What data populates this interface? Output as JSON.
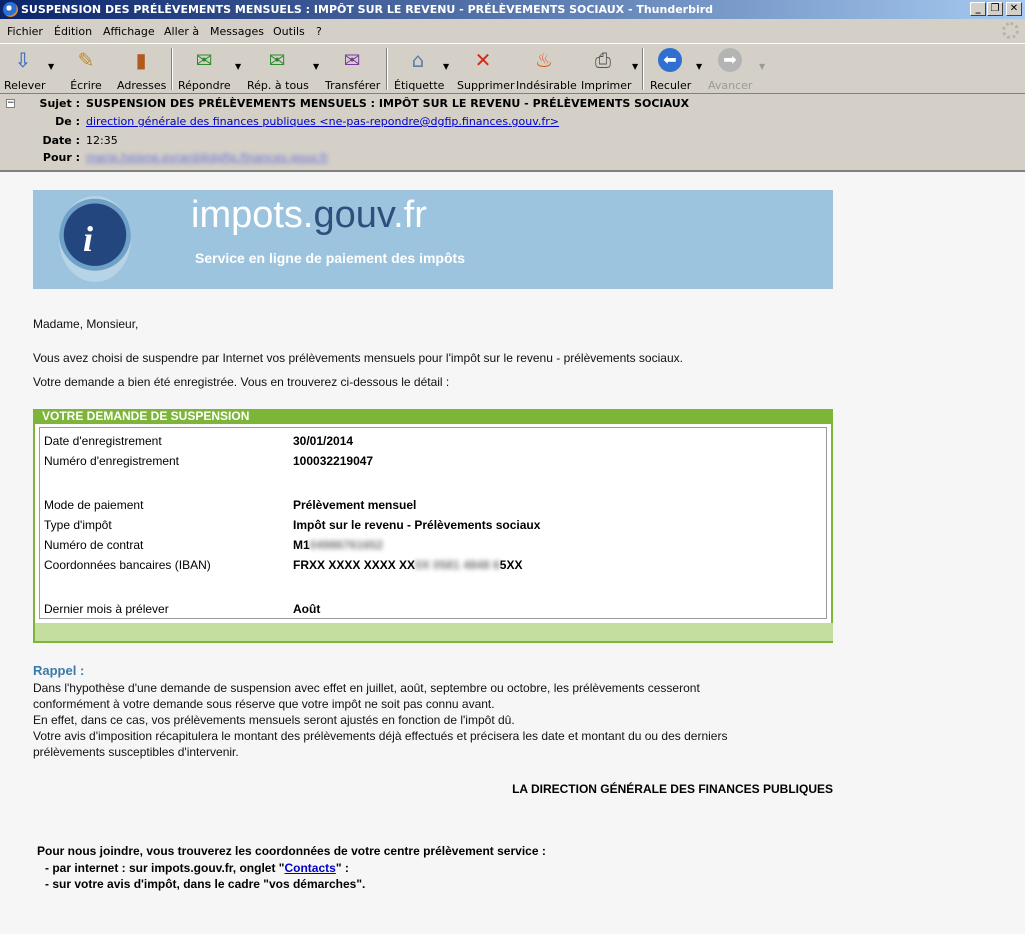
{
  "window": {
    "title": "SUSPENSION DES PRÉLÈVEMENTS MENSUELS : IMPÔT SUR LE REVENU - PRÉLÈVEMENTS SOCIAUX - Thunderbird",
    "minimize": "_",
    "maximize": "❐",
    "close": "✕"
  },
  "menu": [
    "Fichier",
    "Édition",
    "Affichage",
    "Aller à",
    "Messages",
    "Outils",
    "?"
  ],
  "toolbar": {
    "get_mail": "Relever",
    "write": "Écrire",
    "address_book": "Adresses",
    "reply": "Répondre",
    "reply_all": "Rép. à tous",
    "forward": "Transférer",
    "tag": "Étiquette",
    "delete": "Supprimer",
    "junk": "Indésirable",
    "print": "Imprimer",
    "back": "Reculer",
    "forward_nav": "Avancer"
  },
  "header": {
    "subject_label": "Sujet :",
    "subject": "SUSPENSION DES PRÉLÈVEMENTS MENSUELS : IMPÔT SUR LE REVENU - PRÉLÈVEMENTS SOCIAUX",
    "from_label": "De :",
    "from": "direction générale des finances publiques <ne-pas-repondre@dgfip.finances.gouv.fr>",
    "date_label": "Date :",
    "date": "12:35",
    "to_label": "Pour :",
    "to": "marie.helene.evrard@dgfip.finances.gouv.fr"
  },
  "banner": {
    "site_prefix": "impots.",
    "site_mid": "gouv",
    "site_suffix": ".fr",
    "tagline": "Service en ligne de paiement des impôts"
  },
  "message": {
    "greeting": "Madame, Monsieur,",
    "line1": "Vous avez choisi de suspendre par Internet vos prélèvements mensuels pour l'impôt sur le revenu - prélèvements sociaux.",
    "line2": "Votre demande a bien été enregistrée. Vous en trouverez ci-dessous le détail :",
    "box_title": "VOTRE DEMANDE DE SUSPENSION",
    "rows": [
      {
        "label": "Date d'enregistrement",
        "value": "30/01/2014"
      },
      {
        "label": "Numéro d'enregistrement",
        "value": "100032219047"
      },
      {
        "label": "Mode de paiement",
        "value": "Prélèvement mensuel"
      },
      {
        "label": "Type d'impôt",
        "value": "Impôt sur le revenu - Prélèvements sociaux"
      },
      {
        "label": "Numéro de contrat",
        "value_visible": "M1",
        "value_blurred": "04986761652"
      },
      {
        "label": "Coordonnées bancaires (IBAN)",
        "value_visible": "FRXX XXXX XXXX XX",
        "value_blurred": "0X 0581 4848 6",
        "value_end": "5XX"
      },
      {
        "label": "Dernier mois à prélever",
        "value": "Août"
      }
    ],
    "rappel_title": "Rappel :",
    "rappel_lines": [
      "Dans l'hypothèse d'une demande de suspension avec effet en juillet, août, septembre ou octobre, les prélèvements cesseront",
      "conformément à votre demande sous réserve que votre impôt ne soit pas connu avant.",
      "En effet, dans ce cas, vos prélèvements mensuels seront ajustés en fonction de l'impôt dû.",
      "Votre avis d'imposition récapitulera le montant des prélèvements déjà effectués et précisera les date et montant du ou des derniers",
      "prélèvements susceptibles d'intervenir."
    ],
    "signature": "LA DIRECTION GÉNÉRALE DES FINANCES PUBLIQUES",
    "contact_intro": "Pour nous joindre, vous trouverez les coordonnées de votre centre prélèvement service :",
    "contact_line1_pre": "- par internet : sur impots.gouv.fr, onglet \"",
    "contact_link": "Contacts",
    "contact_line1_post": "\" :",
    "contact_line2": "- sur votre avis d'impôt, dans le cadre \"vos démarches\"."
  }
}
